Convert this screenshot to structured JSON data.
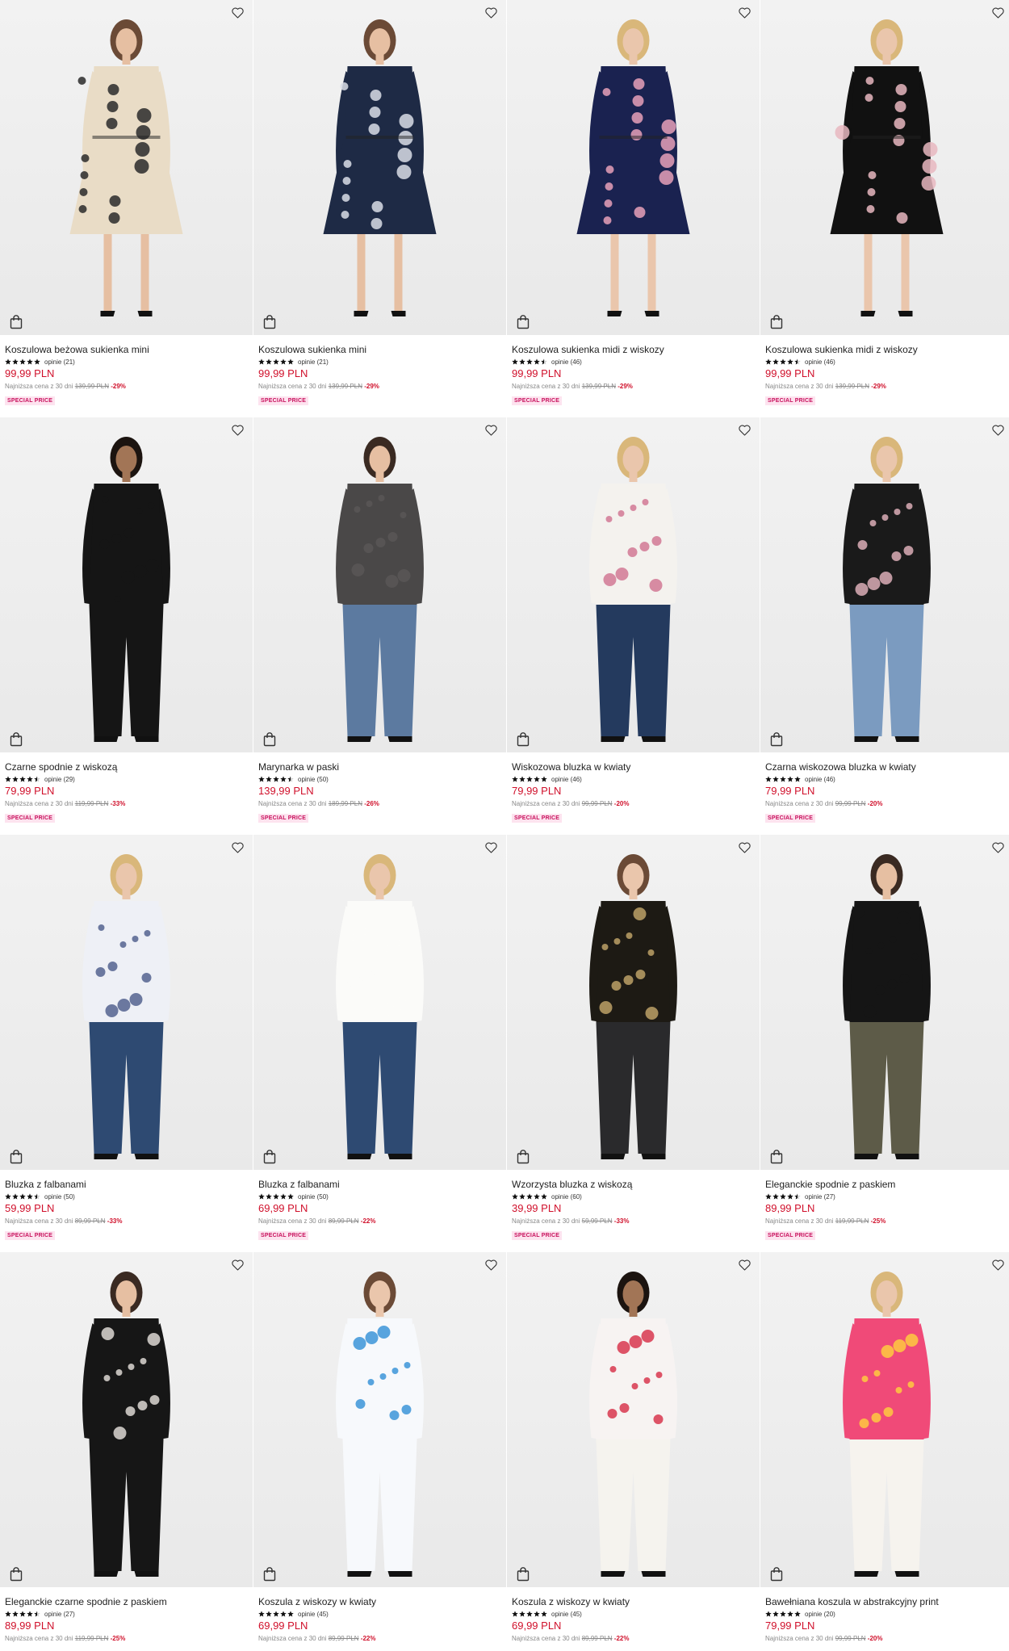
{
  "colors": {
    "price": "#d0102b",
    "badge_bg": "#fde3ef",
    "badge_text": "#c8105c"
  },
  "lowest_prefix": "Najniższa cena z 30 dni",
  "products": [
    {
      "name": "Koszulowa beżowa sukienka mini",
      "stars": 5,
      "reviews": "opinie (21)",
      "price": "99,99 PLN",
      "old": "139,99 PLN",
      "disc": "-29%",
      "badge": "SPECIAL PRICE",
      "top": "#e9dcc6",
      "bottom": "#e9dcc6",
      "pattern": "#2a2a2a",
      "skin": "#e6bfa2",
      "hair": "#6b4a36",
      "legs": true
    },
    {
      "name": "Koszulowa sukienka mini",
      "stars": 5,
      "reviews": "opinie (21)",
      "price": "99,99 PLN",
      "old": "139,99 PLN",
      "disc": "-29%",
      "badge": "SPECIAL PRICE",
      "top": "#1e2a45",
      "bottom": "#1e2a45",
      "pattern": "#d9dde6",
      "skin": "#e6bfa2",
      "hair": "#6b4a36",
      "legs": true
    },
    {
      "name": "Koszulowa sukienka midi z wiskozy",
      "stars": 4.5,
      "reviews": "opinie (46)",
      "price": "99,99 PLN",
      "old": "139,99 PLN",
      "disc": "-29%",
      "badge": "SPECIAL PRICE",
      "top": "#1a2250",
      "bottom": "#1a2250",
      "pattern": "#e7a0b8",
      "skin": "#eac6ac",
      "hair": "#d9b77a",
      "legs": true
    },
    {
      "name": "Koszulowa sukienka midi z wiskozy",
      "stars": 4.5,
      "reviews": "opinie (46)",
      "price": "99,99 PLN",
      "old": "139,99 PLN",
      "disc": "-29%",
      "badge": "SPECIAL PRICE",
      "top": "#111111",
      "bottom": "#111111",
      "pattern": "#e7b7c0",
      "skin": "#eac6ac",
      "hair": "#d9b77a",
      "legs": true
    },
    {
      "name": "Czarne spodnie z wiskozą",
      "stars": 4.5,
      "reviews": "opinie (29)",
      "price": "79,99 PLN",
      "old": "119,99 PLN",
      "disc": "-33%",
      "badge": "SPECIAL PRICE",
      "top": "#151515",
      "bottom": "#151515",
      "pattern": "#151515",
      "skin": "#a27556",
      "hair": "#1c1410",
      "legs": false
    },
    {
      "name": "Marynarka w paski",
      "stars": 4.5,
      "reviews": "opinie (50)",
      "price": "139,99 PLN",
      "old": "189,99 PLN",
      "disc": "-26%",
      "badge": "SPECIAL PRICE",
      "top": "#4a4848",
      "bottom": "#5c7aa0",
      "pattern": "#5a5858",
      "skin": "#e6bfa2",
      "hair": "#3a2a22",
      "legs": false
    },
    {
      "name": "Wiskozowa bluzka w kwiaty",
      "stars": 5,
      "reviews": "opinie (46)",
      "price": "79,99 PLN",
      "old": "99,99 PLN",
      "disc": "-20%",
      "badge": "SPECIAL PRICE",
      "top": "#f4f2ee",
      "bottom": "#243a5e",
      "pattern": "#d0708e",
      "skin": "#eac6ac",
      "hair": "#d9b77a",
      "legs": false
    },
    {
      "name": "Czarna wiskozowa bluzka w kwiaty",
      "stars": 5,
      "reviews": "opinie (46)",
      "price": "79,99 PLN",
      "old": "99,99 PLN",
      "disc": "-20%",
      "badge": "SPECIAL PRICE",
      "top": "#1a1a1a",
      "bottom": "#7b9bc0",
      "pattern": "#e7b7c0",
      "skin": "#eac6ac",
      "hair": "#d9b77a",
      "legs": false
    },
    {
      "name": "Bluzka z falbanami",
      "stars": 4.5,
      "reviews": "opinie (50)",
      "price": "59,99 PLN",
      "old": "89,99 PLN",
      "disc": "-33%",
      "badge": "SPECIAL PRICE",
      "top": "#eef0f6",
      "bottom": "#2e4a72",
      "pattern": "#4a5a8a",
      "skin": "#eac6ac",
      "hair": "#d9b77a",
      "legs": false
    },
    {
      "name": "Bluzka z falbanami",
      "stars": 5,
      "reviews": "opinie (50)",
      "price": "69,99 PLN",
      "old": "89,99 PLN",
      "disc": "-22%",
      "badge": "SPECIAL PRICE",
      "top": "#fbfbf9",
      "bottom": "#2e4a72",
      "pattern": "#fbfbf9",
      "skin": "#eac6ac",
      "hair": "#d9b77a",
      "legs": false
    },
    {
      "name": "Wzorzysta bluzka z wiskozą",
      "stars": 5,
      "reviews": "opinie (60)",
      "price": "39,99 PLN",
      "old": "59,99 PLN",
      "disc": "-33%",
      "badge": "SPECIAL PRICE",
      "top": "#1d1a14",
      "bottom": "#2a2a2c",
      "pattern": "#c7a96b",
      "skin": "#eac6ac",
      "hair": "#6b4a36",
      "legs": false
    },
    {
      "name": "Eleganckie spodnie z paskiem",
      "stars": 4.5,
      "reviews": "opinie (27)",
      "price": "89,99 PLN",
      "old": "119,99 PLN",
      "disc": "-25%",
      "badge": "SPECIAL PRICE",
      "top": "#151515",
      "bottom": "#5d5b48",
      "pattern": "#151515",
      "skin": "#e6bfa2",
      "hair": "#3a2a22",
      "legs": false
    },
    {
      "name": "Eleganckie czarne spodnie z paskiem",
      "stars": 4.5,
      "reviews": "opinie (27)",
      "price": "89,99 PLN",
      "old": "119,99 PLN",
      "disc": "-25%",
      "badge": "",
      "top": "#161616",
      "bottom": "#161616",
      "pattern": "#e8e4df",
      "skin": "#e6bfa2",
      "hair": "#3a2a22",
      "legs": false
    },
    {
      "name": "Koszula z wiskozy w kwiaty",
      "stars": 5,
      "reviews": "opinie (45)",
      "price": "69,99 PLN",
      "old": "89,99 PLN",
      "disc": "-22%",
      "badge": "",
      "top": "#f7f9fc",
      "bottom": "#f7f9fc",
      "pattern": "#2f8fd6",
      "skin": "#eac6ac",
      "hair": "#6b4a36",
      "legs": false
    },
    {
      "name": "Koszula z wiskozy w kwiaty",
      "stars": 5,
      "reviews": "opinie (45)",
      "price": "69,99 PLN",
      "old": "89,99 PLN",
      "disc": "-22%",
      "badge": "",
      "top": "#f7f3f2",
      "bottom": "#f5f3ee",
      "pattern": "#d62a44",
      "skin": "#a27556",
      "hair": "#1c1410",
      "legs": false
    },
    {
      "name": "Bawełniana koszula w abstrakcyjny print",
      "stars": 5,
      "reviews": "opinie (20)",
      "price": "79,99 PLN",
      "old": "99,99 PLN",
      "disc": "-20%",
      "badge": "",
      "top": "#f04a78",
      "bottom": "#f6f3ee",
      "pattern": "#ffd23c",
      "skin": "#eac6ac",
      "hair": "#d9b77a",
      "legs": false
    }
  ]
}
